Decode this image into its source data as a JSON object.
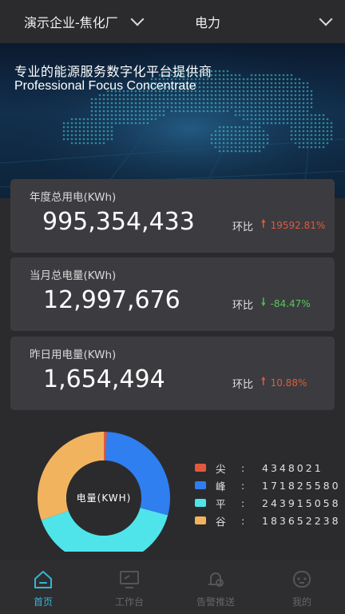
{
  "header": {
    "enterprise": "演示企业-焦化厂",
    "energy_type": "电力"
  },
  "banner": {
    "title": "专业的能源服务数字化平台提供商",
    "subtitle": "Professional Focus Concentrate"
  },
  "cards": [
    {
      "label": "年度总用电(KWh)",
      "value": "995,354,433",
      "ratio_label": "环比",
      "direction": "up",
      "ratio": "19592.81%"
    },
    {
      "label": "当月总电量(KWh)",
      "value": "12,997,676",
      "ratio_label": "环比",
      "direction": "down",
      "ratio": "-84.47%"
    },
    {
      "label": "昨日用电量(KWh)",
      "value": "1,654,494",
      "ratio_label": "环比",
      "direction": "up",
      "ratio": "10.88%"
    }
  ],
  "chart_data": {
    "type": "pie",
    "center_label": "电量(KWH)",
    "categories": [
      "尖",
      "峰",
      "平",
      "谷"
    ],
    "values": [
      4348021,
      171825580,
      243915058,
      183652238
    ],
    "value_labels": [
      "4348021",
      "171825580",
      "243915058",
      "183652238"
    ],
    "colors": [
      "#e0593b",
      "#2f7ff0",
      "#4fe4ea",
      "#f2b35f"
    ]
  },
  "tabs": [
    {
      "label": "首页",
      "icon": "home-icon",
      "active": true
    },
    {
      "label": "工作台",
      "icon": "workbench-icon",
      "active": false
    },
    {
      "label": "告警推送",
      "icon": "alarm-icon",
      "active": false
    },
    {
      "label": "我的",
      "icon": "profile-icon",
      "active": false
    }
  ],
  "colors": {
    "accent": "#35b6d4",
    "up": "#e0593b",
    "down": "#44c24a"
  }
}
